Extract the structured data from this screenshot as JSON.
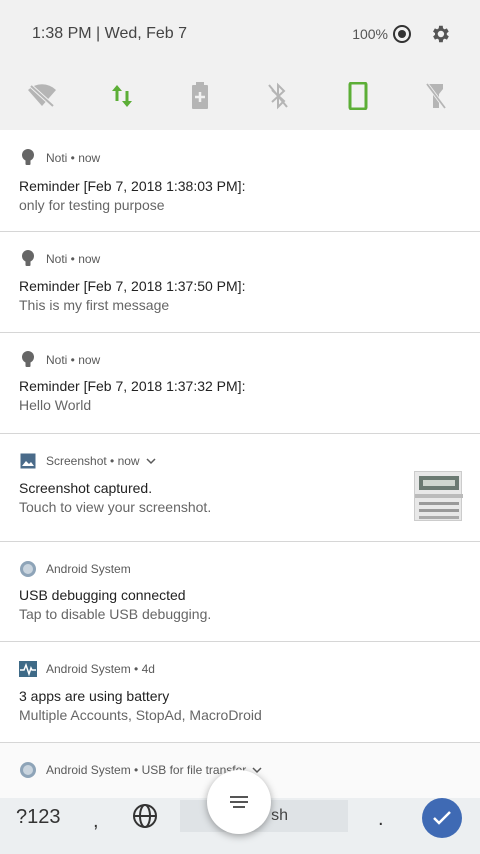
{
  "status": {
    "time_date": "1:38 PM  |  Wed, Feb 7",
    "battery": "100%"
  },
  "quick_settings": [
    {
      "icon": "wifi-off-icon"
    },
    {
      "icon": "data-transfer-icon"
    },
    {
      "icon": "battery-saver-icon"
    },
    {
      "icon": "bluetooth-off-icon"
    },
    {
      "icon": "auto-rotate-icon"
    },
    {
      "icon": "flashlight-off-icon"
    }
  ],
  "notifications": [
    {
      "app": "Noti • now",
      "title": "Reminder [Feb 7, 2018 1:38:03 PM]:",
      "body": "only for testing purpose"
    },
    {
      "app": "Noti • now",
      "title": "Reminder [Feb 7, 2018 1:37:50 PM]:",
      "body": "This is my first message"
    },
    {
      "app": "Noti • now",
      "title": "Reminder [Feb 7, 2018 1:37:32 PM]:",
      "body": "Hello World"
    },
    {
      "app": "Screenshot • now",
      "title": "Screenshot captured.",
      "body": "Touch to view your screenshot."
    },
    {
      "app": "Android System",
      "title": "USB debugging connected",
      "body": "Tap to disable USB debugging."
    },
    {
      "app": "Android System • 4d",
      "title": "3 apps are using battery",
      "body": "Multiple Accounts, StopAd, MacroDroid"
    },
    {
      "app": "Android System • USB for file transfer",
      "title": "",
      "body": ""
    }
  ],
  "keyboard": {
    "symbols_key": "?123",
    "comma_key": ",",
    "space_label": "sh",
    "period_key": "."
  },
  "colors": {
    "accent_green": "#5cae36",
    "icon_gray": "#9e9e9e",
    "enter_blue": "#3f6ab4"
  }
}
